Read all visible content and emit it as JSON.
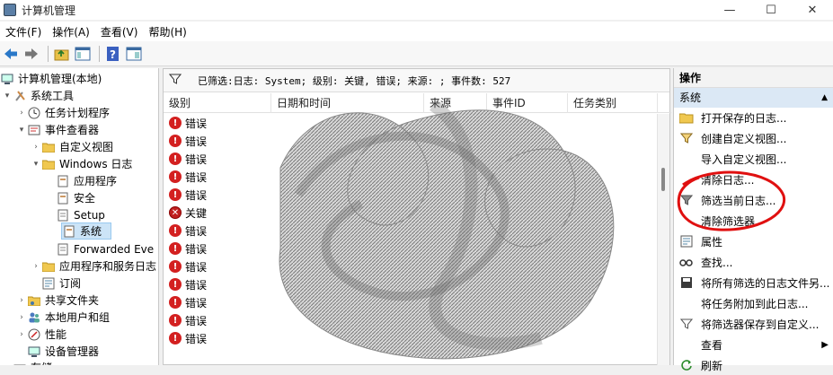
{
  "window": {
    "title": "计算机管理",
    "min": "—",
    "max": "☐",
    "close": "✕"
  },
  "menu": [
    "文件(F)",
    "操作(A)",
    "查看(V)",
    "帮助(H)"
  ],
  "toolbar": {
    "icons": [
      "back-icon",
      "forward-icon",
      "up-folder-icon",
      "show-tree-icon",
      "help-icon",
      "show-pane-icon"
    ]
  },
  "tree": {
    "root": "计算机管理(本地)",
    "system_tools": "系统工具",
    "task_scheduler": "任务计划程序",
    "event_viewer": "事件查看器",
    "custom_views": "自定义视图",
    "windows_logs": "Windows 日志",
    "application": "应用程序",
    "security": "安全",
    "setup": "Setup",
    "system": "系统",
    "forwarded": "Forwarded Eve",
    "app_services_logs": "应用程序和服务日志",
    "subscriptions": "订阅",
    "shared_folders": "共享文件夹",
    "local_users": "本地用户和组",
    "performance": "性能",
    "device_manager": "设备管理器",
    "storage": "存储"
  },
  "main": {
    "filter_text": "已筛选:日志: System; 级别: 关键, 错误; 来源: ; 事件数: 527",
    "columns": [
      "级别",
      "日期和时间",
      "来源",
      "事件ID",
      "任务类别"
    ],
    "rows": [
      {
        "level": "错误",
        "type": "err"
      },
      {
        "level": "错误",
        "type": "err"
      },
      {
        "level": "错误",
        "type": "err"
      },
      {
        "level": "错误",
        "type": "err"
      },
      {
        "level": "错误",
        "type": "err"
      },
      {
        "level": "关键",
        "type": "crit"
      },
      {
        "level": "错误",
        "type": "err"
      },
      {
        "level": "错误",
        "type": "err"
      },
      {
        "level": "错误",
        "type": "err"
      },
      {
        "level": "错误",
        "type": "err"
      },
      {
        "level": "错误",
        "type": "err"
      },
      {
        "level": "错误",
        "type": "err"
      },
      {
        "level": "错误",
        "type": "err"
      }
    ]
  },
  "actions": {
    "header": "操作",
    "section": "系统",
    "items": [
      "打开保存的日志...",
      "创建自定义视图...",
      "导入自定义视图...",
      "清除日志...",
      "筛选当前日志...",
      "清除筛选器",
      "属性",
      "查找...",
      "将所有筛选的日志文件另...",
      "将任务附加到此日志...",
      "将筛选器保存到自定义...",
      "查看",
      "刷新"
    ]
  },
  "colors": {
    "selection": "#cce4f7",
    "error": "#d32020",
    "annotation": "#e01010",
    "action_section": "#dbe8f5"
  }
}
